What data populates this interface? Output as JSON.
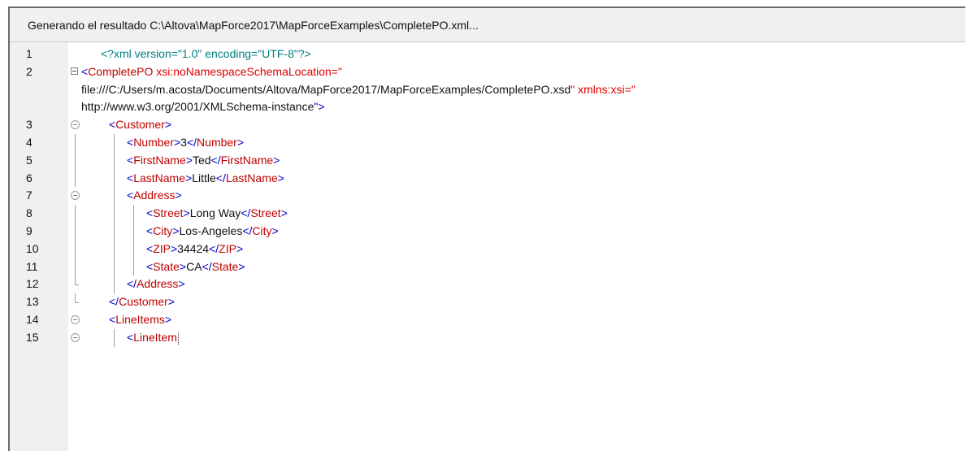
{
  "status": {
    "message": "Generando el resultado C:\\Altova\\MapForce2017\\MapForceExamples\\CompletePO.xml..."
  },
  "editor": {
    "lines": [
      {
        "num": "1",
        "parts": {
          "p0": "<?xml version=\"1.0\" encoding=\"UTF-8\"?>"
        }
      },
      {
        "num": "2",
        "parts": {
          "p0": "<",
          "p1": "CompletePO",
          "p2": " xsi:noNamespaceSchemaLocation=\""
        }
      },
      {
        "num": "",
        "parts": {
          "p0": "file:///C:/Users/m.acosta/Documents/Altova/MapForce2017/MapForceExamples/CompletePO.xsd",
          "p1": "\"",
          "p2": " xmlns:xsi=\""
        }
      },
      {
        "num": "",
        "parts": {
          "p0": "http://www.w3.org/2001/XMLSchema-instance",
          "p1": "\">"
        }
      },
      {
        "num": "3",
        "parts": {
          "p0": "<",
          "p1": "Customer",
          "p2": ">"
        }
      },
      {
        "num": "4",
        "parts": {
          "p0": "<",
          "p1": "Number",
          "p2": ">",
          "p3": "3",
          "p4": "</",
          "p5": "Number",
          "p6": ">"
        }
      },
      {
        "num": "5",
        "parts": {
          "p0": "<",
          "p1": "FirstName",
          "p2": ">",
          "p3": "Ted",
          "p4": "</",
          "p5": "FirstName",
          "p6": ">"
        }
      },
      {
        "num": "6",
        "parts": {
          "p0": "<",
          "p1": "LastName",
          "p2": ">",
          "p3": "Little",
          "p4": "</",
          "p5": "LastName",
          "p6": ">"
        }
      },
      {
        "num": "7",
        "parts": {
          "p0": "<",
          "p1": "Address",
          "p2": ">"
        }
      },
      {
        "num": "8",
        "parts": {
          "p0": "<",
          "p1": "Street",
          "p2": ">",
          "p3": "Long Way",
          "p4": "</",
          "p5": "Street",
          "p6": ">"
        }
      },
      {
        "num": "9",
        "parts": {
          "p0": "<",
          "p1": "City",
          "p2": ">",
          "p3": "Los-Angeles",
          "p4": "</",
          "p5": "City",
          "p6": ">"
        }
      },
      {
        "num": "10",
        "parts": {
          "p0": "<",
          "p1": "ZIP",
          "p2": ">",
          "p3": "34424",
          "p4": "</",
          "p5": "ZIP",
          "p6": ">"
        }
      },
      {
        "num": "11",
        "parts": {
          "p0": "<",
          "p1": "State",
          "p2": ">",
          "p3": "CA",
          "p4": "</",
          "p5": "State",
          "p6": ">"
        }
      },
      {
        "num": "12",
        "parts": {
          "p0": "</",
          "p1": "Address",
          "p2": ">"
        }
      },
      {
        "num": "13",
        "parts": {
          "p0": "</",
          "p1": "Customer",
          "p2": ">"
        }
      },
      {
        "num": "14",
        "parts": {
          "p0": "<",
          "p1": "LineItems",
          "p2": ">"
        }
      },
      {
        "num": "15",
        "parts": {
          "p0": "<",
          "p1": "LineItem"
        }
      }
    ]
  }
}
